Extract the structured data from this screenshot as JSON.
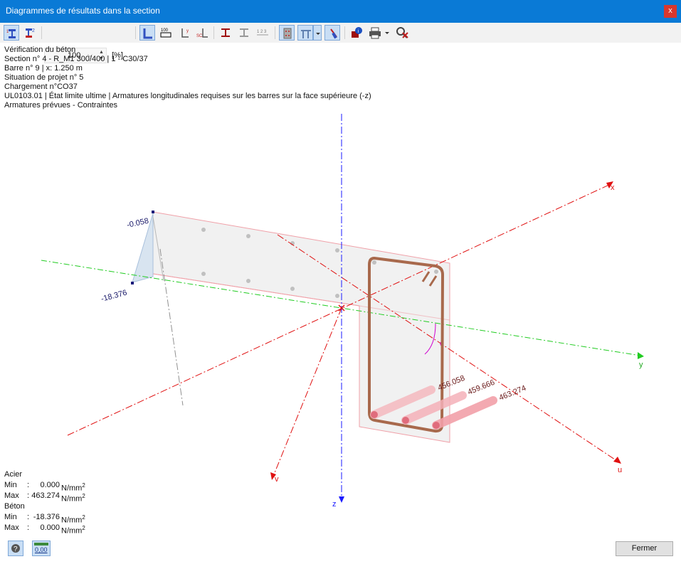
{
  "window": {
    "title": "Diagrammes de résultats dans la section",
    "close_label": "x"
  },
  "toolbar": {
    "zoom_value": "100",
    "zoom_unit": "[%]",
    "icons": [
      "section-results-icon",
      "stress-icon",
      "zoom-input",
      "section-outline-icon",
      "values-icon",
      "axes-icon",
      "stress-points-icon",
      "member-icon",
      "member-alt-icon",
      "numbering-icon",
      "render-solid-icon",
      "render-mode-icon",
      "render-dropdown-icon",
      "pointer-icon",
      "info-icon",
      "print-icon",
      "print-dropdown-icon",
      "zoom-reset-icon"
    ]
  },
  "info": {
    "line1": "Vérification du béton",
    "line2": "Section n° 4 - R_M1 300/400 | 1 - C30/37",
    "line3": "Barre n° 9 | x: 1.250 m",
    "line4": "Situation de projet n° 5",
    "line5": "Chargement n°CO37",
    "line6": "UL0103.01 | État limite ultime | Armatures longitudinales requises sur les barres sur la face supérieure (-z)",
    "line7": "Armatures prévues - Contraintes"
  },
  "diagram": {
    "axes": {
      "x": "x",
      "y": "y",
      "z": "z",
      "u": "u",
      "v": "v",
      "alpha": "α"
    },
    "concrete_values": {
      "top": "-0.058",
      "bottom": "-18.376"
    },
    "steel_values": {
      "bar1": "456.058",
      "bar2": "459.666",
      "bar3": "463.274"
    },
    "colors": {
      "axis_red": "#e01010",
      "axis_green": "#22cc22",
      "axis_blue": "#1a1aff",
      "rebar": "#b87a5a",
      "stirrup": "#a8694c",
      "bar_pink": "#f2a0a8"
    }
  },
  "legend": {
    "steel_title": "Acier",
    "steel_min_label": "Min",
    "steel_min_value": "0.000",
    "steel_max_label": "Max",
    "steel_max_value": "463.274",
    "concrete_title": "Béton",
    "concrete_min_label": "Min",
    "concrete_min_value": "-18.376",
    "concrete_max_label": "Max",
    "concrete_max_value": "0.000",
    "unit": "N/mm",
    "unit_exp": "2"
  },
  "footer": {
    "values_button": "0,00",
    "close_button": "Fermer"
  }
}
